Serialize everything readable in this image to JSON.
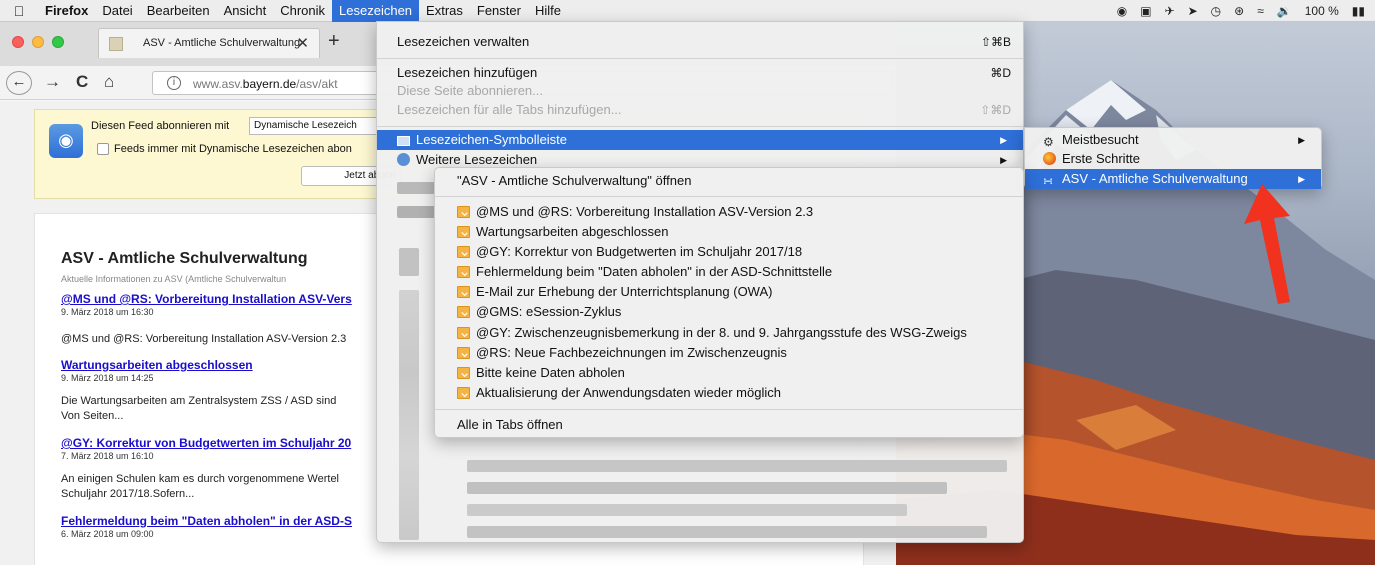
{
  "menubar": {
    "app": "Firefox",
    "items": [
      "Datei",
      "Bearbeiten",
      "Ansicht",
      "Chronik",
      "Lesezeichen",
      "Extras",
      "Fenster",
      "Hilfe"
    ],
    "active_index": 4,
    "battery": "100 %"
  },
  "browser": {
    "tab_title": "ASV - Amtliche Schulverwaltung",
    "url_host": "www.asv.",
    "url_domain": "bayern.de",
    "url_path": "/asv/akt"
  },
  "feed": {
    "label": "Diesen Feed abonnieren mit",
    "select_value": "Dynamische Lesezeich",
    "checkbox_label": "Feeds immer mit Dynamische Lesezeichen abon",
    "button_label": "Jetzt abonn"
  },
  "article": {
    "title": "ASV - Amtliche Schulverwaltung",
    "subtitle": "Aktuelle Informationen zu ASV (Amtliche Schulverwaltun",
    "entries": [
      {
        "title": "@MS und @RS: Vorbereitung Installation ASV-Vers",
        "date": "9. März 2018 um 16:30",
        "text": [
          "@MS und @RS: Vorbereitung Installation ASV-Version 2.3"
        ]
      },
      {
        "title": "Wartungsarbeiten abgeschlossen",
        "date": "9. März 2018 um 14:25",
        "text": [
          "Die Wartungsarbeiten am Zentralsystem ZSS / ASD sind",
          "Von Seiten..."
        ]
      },
      {
        "title": "@GY: Korrektur von Budgetwerten im Schuljahr 20",
        "date": "7. März 2018 um 16:10",
        "text": [
          "An einigen Schulen kam es durch vorgenommene Wertel",
          "Schuljahr 2017/18.Sofern..."
        ]
      },
      {
        "title": "Fehlermeldung beim \"Daten abholen\" in der ASD-S",
        "date": "6. März 2018 um 09:00",
        "text": []
      }
    ]
  },
  "bookmarks_menu": {
    "manage": {
      "label": "Lesezeichen verwalten",
      "shortcut": "⇧⌘B"
    },
    "add": {
      "label": "Lesezeichen hinzufügen",
      "shortcut": "⌘D"
    },
    "subscribe": {
      "label": "Diese Seite abonnieren..."
    },
    "add_all": {
      "label": "Lesezeichen für alle Tabs hinzufügen...",
      "shortcut": "⇧⌘D"
    },
    "toolbar": {
      "label": "Lesezeichen-Symbolleiste"
    },
    "other": {
      "label": "Weitere Lesezeichen"
    }
  },
  "toolbar_submenu": {
    "items": [
      "Meistbesucht",
      "Erste Schritte",
      "ASV - Amtliche Schulverwaltung"
    ]
  },
  "feed_submenu": {
    "open": "\"ASV - Amtliche Schulverwaltung\" öffnen",
    "items": [
      "@MS und @RS: Vorbereitung Installation ASV-Version 2.3",
      "Wartungsarbeiten abgeschlossen",
      "@GY: Korrektur von Budgetwerten im Schuljahr 2017/18",
      "Fehlermeldung beim \"Daten abholen\" in der ASD-Schnittstelle",
      "E-Mail zur Erhebung der Unterrichtsplanung (OWA)",
      "@GMS: eSession-Zyklus",
      "@GY: Zwischenzeugnisbemerkung in der 8. und 9. Jahrgangsstufe des WSG-Zweigs",
      "@RS: Neue Fachbezeichnungen im Zwischenzeugnis",
      "Bitte keine Daten abholen",
      "Aktualisierung der Anwendungsdaten wieder möglich"
    ],
    "open_all": "Alle in Tabs öffnen"
  },
  "colors": {
    "highlight": "#2e6fd8",
    "link": "#1a0dcc",
    "arrow": "#f0321e"
  }
}
